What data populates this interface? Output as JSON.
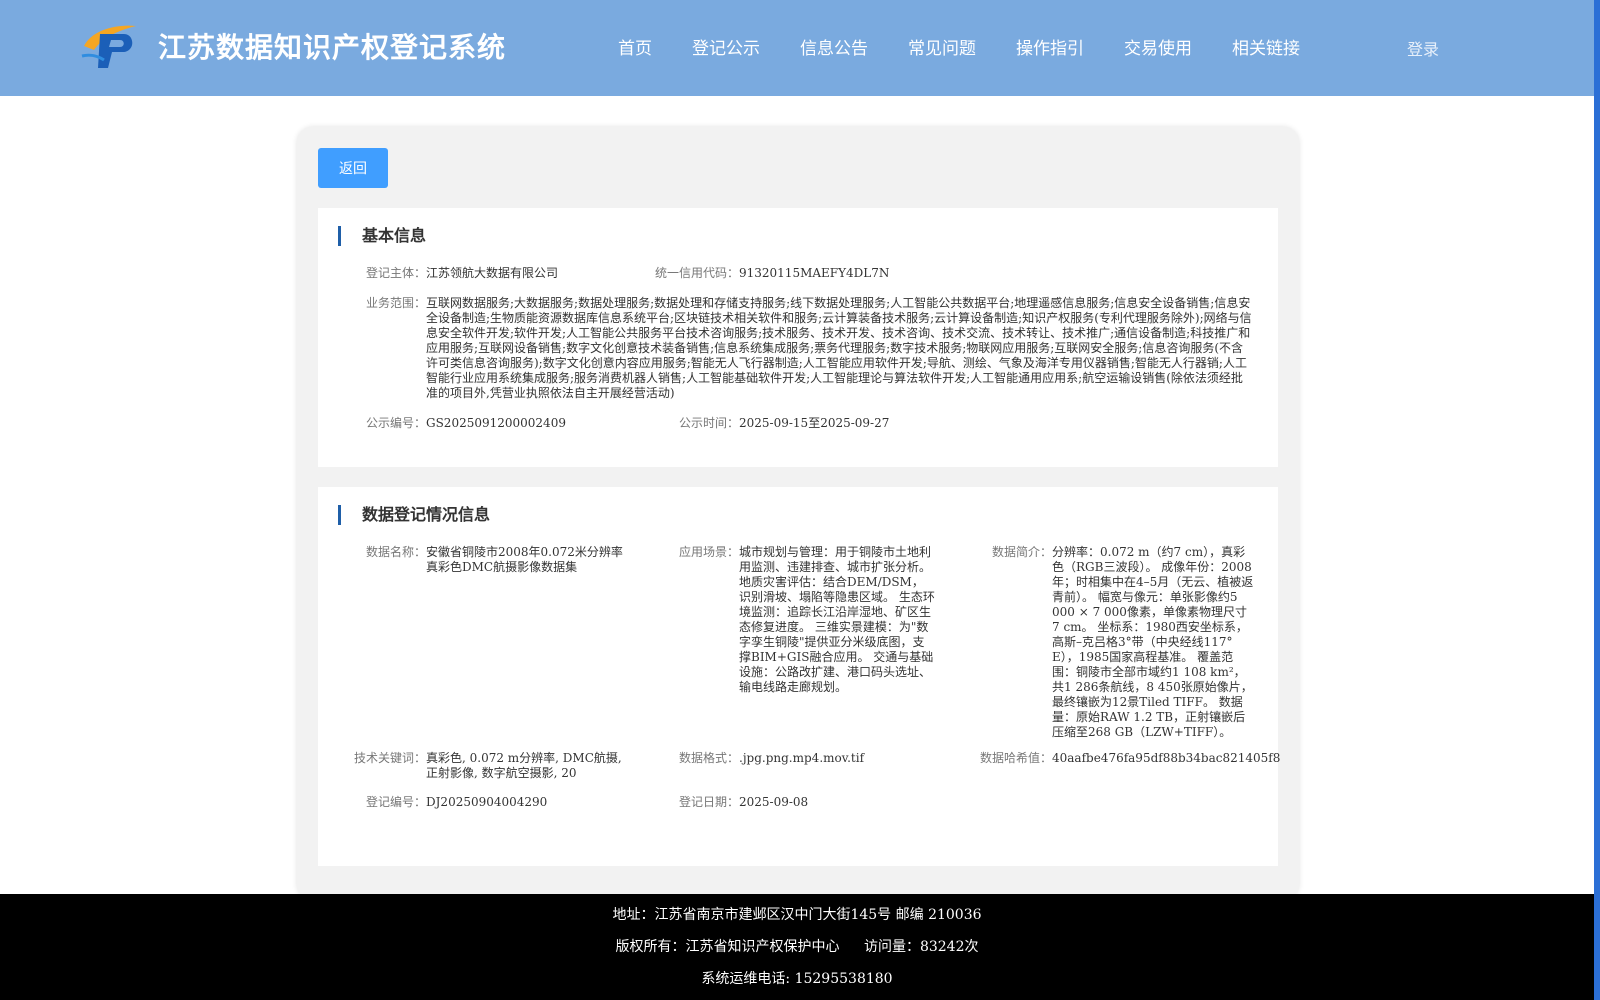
{
  "header": {
    "site_title": "江苏数据知识产权登记系统",
    "nav": [
      "首页",
      "登记公示",
      "信息公告",
      "常见问题",
      "操作指引",
      "交易使用",
      "相关链接"
    ],
    "login": "登录"
  },
  "toolbar": {
    "back_label": "返回"
  },
  "basic_info": {
    "title": "基本信息",
    "subject_label": "登记主体：",
    "subject": "江苏领航大数据有限公司",
    "credit_code_label": "统一信用代码：",
    "credit_code": "91320115MAEFY4DL7N",
    "scope_label": "业务范围：",
    "scope": "互联网数据服务;大数据服务;数据处理服务;数据处理和存储支持服务;线下数据处理服务;人工智能公共数据平台;地理遥感信息服务;信息安全设备销售;信息安全设备制造;生物质能资源数据库信息系统平台;区块链技术相关软件和服务;云计算装备技术服务;云计算设备制造;知识产权服务(专利代理服务除外);网络与信息安全软件开发;软件开发;人工智能公共服务平台技术咨询服务;技术服务、技术开发、技术咨询、技术交流、技术转让、技术推广;通信设备制造;科技推广和应用服务;互联网设备销售;数字文化创意技术装备销售;信息系统集成服务;票务代理服务;数字技术服务;物联网应用服务;互联网安全服务;信息咨询服务(不含许可类信息咨询服务);数字文化创意内容应用服务;智能无人飞行器制造;人工智能应用软件开发;导航、测绘、气象及海洋专用仪器销售;智能无人行器销;人工智能行业应用系统集成服务;服务消费机器人销售;人工智能基础软件开发;人工智能理论与算法软件开发;人工智能通用应用系;航空运输设销售(除依法须经批准的项目外,凭营业执照依法自主开展经营活动)",
    "pub_no_label": "公示编号：",
    "pub_no": "GS2025091200002409",
    "pub_time_label": "公示时间：",
    "pub_time": "2025-09-15至2025-09-27"
  },
  "data_info": {
    "title": "数据登记情况信息",
    "name_label": "数据名称：",
    "name": "安徽省铜陵市2008年0.072米分辨率真彩色DMC航摄影像数据集",
    "scene_label": "应用场景：",
    "scene": "城市规划与管理：用于铜陵市土地利用监测、违建排查、城市扩张分析。 地质灾害评估：结合DEM/DSM，识别滑坡、塌陷等隐患区域。 生态环境监测：追踪长江沿岸湿地、矿区生态修复进度。 三维实景建模：为\"数字孪生铜陵\"提供亚分米级底图，支撑BIM+GIS融合应用。 交通与基础设施：公路改扩建、港口码头选址、输电线路走廊规划。",
    "intro_label": "数据简介：",
    "intro": "分辨率：0.072 m（约7 cm），真彩色（RGB三波段）。 成像年份：2008年；时相集中在4–5月（无云、植被返青前）。 幅宽与像元：单张影像约5 000 × 7 000像素，单像素物理尺寸7 cm。 坐标系：1980西安坐标系，高斯–克吕格3°带（中央经线117° E），1985国家高程基准。 覆盖范围：铜陵市全部市域约1 108 km²，共1 286条航线，8 450张原始像片，最终镶嵌为12景Tiled TIFF。 数据量：原始RAW 1.2 TB，正射镶嵌后压缩至268 GB（LZW+TIFF）。",
    "keywords_label": "技术关键词：",
    "keywords": "真彩色, 0.072 m分辨率, DMC航摄, 正射影像, 数字航空摄影, 20",
    "format_label": "数据格式：",
    "format": ".jpg.png.mp4.mov.tif",
    "hash_label": "数据哈希值：",
    "hash": "40aafbe476fa95df88b34bac821405f8",
    "reg_no_label": "登记编号：",
    "reg_no": "DJ20250904004290",
    "reg_date_label": "登记日期：",
    "reg_date": "2025-09-08"
  },
  "footer": {
    "address": "地址：江苏省南京市建邺区汉中门大街145号 邮编 210036",
    "copyright": "版权所有：江苏省知识产权保护中心",
    "visits": "访问量：83242次",
    "phone": "系统运维电话: 15295538180"
  },
  "colors": {
    "header_bg": "#7aaadf",
    "accent_button": "#409eff",
    "title_bar": "#1f5fa8",
    "footer_bg": "#000000"
  }
}
